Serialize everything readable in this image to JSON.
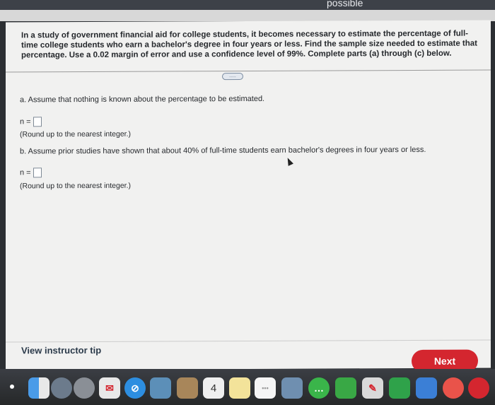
{
  "header": {
    "partial_word": "possible"
  },
  "question": {
    "text": "In a study of government financial aid for college students, it becomes necessary to estimate the percentage of full-time college students who earn a bachelor's degree in four years or less. Find the sample size needed to estimate that percentage. Use a 0.02 margin of error and use a confidence level of 99%. Complete parts (a) through (c) below."
  },
  "more_button": {
    "label": "....."
  },
  "part_a": {
    "prompt": "a. Assume that nothing is known about the percentage to be estimated.",
    "n_label": "n =",
    "answer_value": "",
    "hint": "(Round up to the nearest integer.)"
  },
  "part_b": {
    "prompt": "b. Assume prior studies have shown that about 40% of full-time students earn bachelor's degrees in four years or less.",
    "n_label": "n =",
    "answer_value": "",
    "hint": "(Round up to the nearest integer.)"
  },
  "footer": {
    "instructor_tip": "View instructor tip",
    "next_label": "Next"
  },
  "dock": {
    "calendar_day": "4",
    "icons": [
      "finder-icon",
      "launchpad-icon",
      "rocket-icon",
      "mail-icon",
      "safari-icon",
      "preview-icon",
      "notes-icon",
      "calendar-icon",
      "notepad-icon",
      "reminders-icon",
      "photos-icon",
      "messages-icon",
      "facetime-icon",
      "pen-icon",
      "numbers-icon",
      "keynote-icon",
      "news-icon"
    ]
  },
  "colors": {
    "next_button": "#d4262f",
    "page_background": "#f1f1f0",
    "text": "#26292d"
  }
}
